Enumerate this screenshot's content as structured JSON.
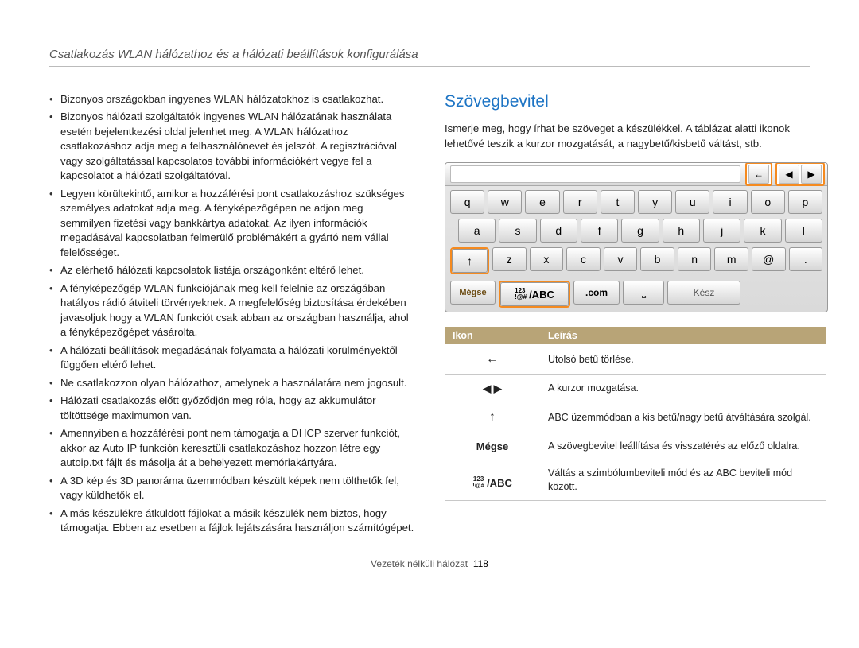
{
  "header": "Csatlakozás WLAN hálózathoz és a hálózati beállítások konfigurálása",
  "bullets": [
    "Bizonyos országokban ingyenes WLAN hálózatokhoz is csatlakozhat.",
    "Bizonyos hálózati szolgáltatók ingyenes WLAN hálózatának használata esetén bejelentkezési oldal jelenhet meg. A WLAN hálózathoz csatlakozáshoz adja meg a felhasználónevet és jelszót. A regisztrációval vagy szolgáltatással kapcsolatos további információkért vegye fel a kapcsolatot a hálózati szolgáltatóval.",
    "Legyen körültekintő, amikor a hozzáférési pont csatlakozáshoz szükséges személyes adatokat adja meg. A fényképezőgépen ne adjon meg semmilyen fizetési vagy bankkártya adatokat. Az ilyen információk megadásával kapcsolatban felmerülő problémákért a gyártó nem vállal felelősséget.",
    "Az elérhető hálózati kapcsolatok listája országonként eltérő lehet.",
    "A fényképezőgép WLAN funkciójának meg kell felelnie az országában hatályos rádió átviteli törvényeknek. A megfelelőség biztosítása érdekében javasoljuk hogy a WLAN funkciót csak abban az országban használja, ahol a fényképezőgépet vásárolta.",
    "A hálózati beállítások megadásának folyamata a hálózati körülményektől függően eltérő lehet.",
    "Ne csatlakozzon olyan hálózathoz, amelynek a használatára nem jogosult.",
    "Hálózati csatlakozás előtt győződjön meg róla, hogy az akkumulátor töltöttsége maximumon van.",
    "Amennyiben a hozzáférési pont nem támogatja a DHCP szerver funkciót, akkor az Auto IP funkción keresztüli csatlakozáshoz hozzon létre egy autoip.txt fájlt és másolja át a behelyezett memóriakártyára.",
    "A 3D kép és 3D panoráma üzemmódban készült képek nem tölthetők fel, vagy küldhetők el.",
    "A más készülékre átküldött fájlokat a másik készülék nem biztos, hogy támogatja. Ebben az esetben a fájlok lejátszására használjon számítógépet."
  ],
  "section_title": "Szövegbevitel",
  "intro": "Ismerje meg, hogy írhat be szöveget a készülékkel. A táblázat alatti ikonok lehetővé teszik a kurzor mozgatását, a nagybetű/kisbetű váltást, stb.",
  "keyboard": {
    "row1": [
      "q",
      "w",
      "e",
      "r",
      "t",
      "y",
      "u",
      "i",
      "o",
      "p"
    ],
    "row2": [
      "a",
      "s",
      "d",
      "f",
      "g",
      "h",
      "j",
      "k",
      "l"
    ],
    "row3_shift": "↑",
    "row3": [
      "z",
      "x",
      "c",
      "v",
      "b",
      "n",
      "m",
      "@",
      "."
    ],
    "cancel": "Mégse",
    "abc_sup1": "123",
    "abc_sup2": "!@#",
    "abc_main": "/ABC",
    "com": ".com",
    "space": "␣",
    "done": "Kész",
    "nav_back": "←",
    "nav_left": "◀",
    "nav_right": "▶"
  },
  "table": {
    "h_icon": "Ikon",
    "h_desc": "Leírás",
    "rows": [
      {
        "icon": "←",
        "desc": "Utolsó betű törlése."
      },
      {
        "icon": "◀  ▶",
        "desc": "A kurzor mozgatása."
      },
      {
        "icon": "↑",
        "desc": "ABC üzemmódban a kis betű/nagy betű átváltására szolgál."
      },
      {
        "icon": "Mégse",
        "desc": "A szövegbevitel leállítása és visszatérés az előző oldalra."
      },
      {
        "icon": "ABC",
        "desc": "Váltás a szimbólumbeviteli mód és az ABC beviteli mód között."
      }
    ]
  },
  "footer_label": "Vezeték nélküli hálózat",
  "footer_page": "118"
}
